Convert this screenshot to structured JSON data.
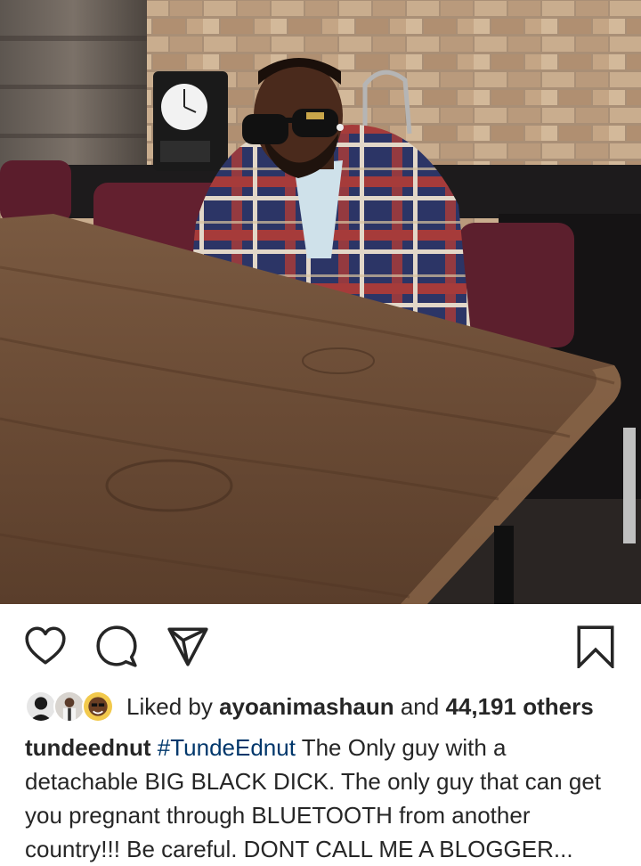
{
  "post": {
    "image_alt": "Man in plaid jacket and sunglasses seated at a long wooden table",
    "actions": {
      "like_icon": "heart-outline-icon",
      "comment_icon": "comment-bubble-icon",
      "share_icon": "paper-plane-icon",
      "save_icon": "bookmark-outline-icon"
    },
    "likes": {
      "prefix": "Liked by",
      "user": "ayoanimashaun",
      "connector": "and",
      "count": "44,191 others"
    },
    "caption": {
      "username": "tundeednut",
      "hashtag": "#TundeEdnut",
      "text": "The Only guy with a detachable BIG BLACK DICK. The only guy that can get you pregnant through BLUETOOTH from another country!!! Be careful. DONT CALL ME A BLOGGER..."
    },
    "colors": {
      "text": "#262626",
      "hashtag": "#00376b",
      "background": "#ffffff"
    }
  }
}
